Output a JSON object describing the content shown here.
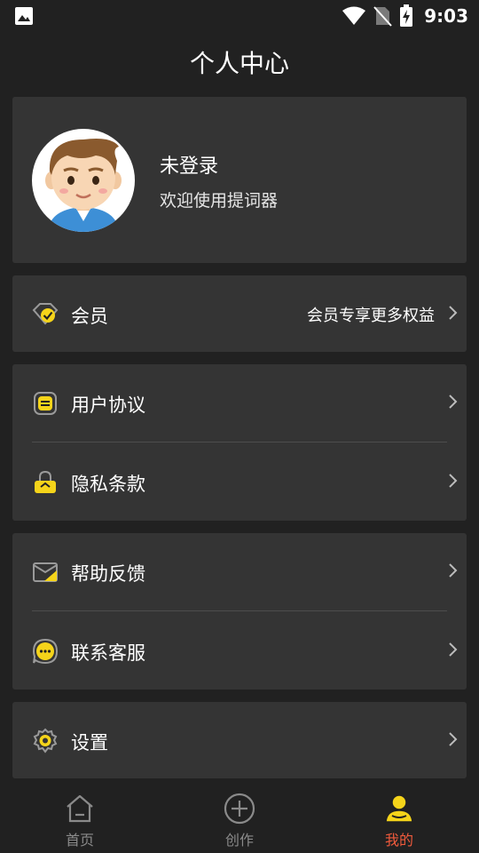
{
  "status_bar": {
    "time": "9:03"
  },
  "header": {
    "title": "个人中心"
  },
  "profile": {
    "name": "未登录",
    "subtitle": "欢迎使用提词器"
  },
  "menu": {
    "vip": {
      "label": "会员",
      "right_text": "会员专享更多权益"
    },
    "user_agreement": {
      "label": "用户协议"
    },
    "privacy": {
      "label": "隐私条款"
    },
    "feedback": {
      "label": "帮助反馈"
    },
    "support": {
      "label": "联系客服"
    },
    "settings": {
      "label": "设置"
    }
  },
  "tabbar": {
    "items": [
      {
        "label": "首页",
        "icon": "home-icon",
        "active": false
      },
      {
        "label": "创作",
        "icon": "add-circle-icon",
        "active": false
      },
      {
        "label": "我的",
        "icon": "person-icon",
        "active": true
      }
    ]
  },
  "colors": {
    "background": "#212121",
    "card": "#343434",
    "accent_yellow": "#f5d41a",
    "active_tab": "#f05a3c"
  }
}
